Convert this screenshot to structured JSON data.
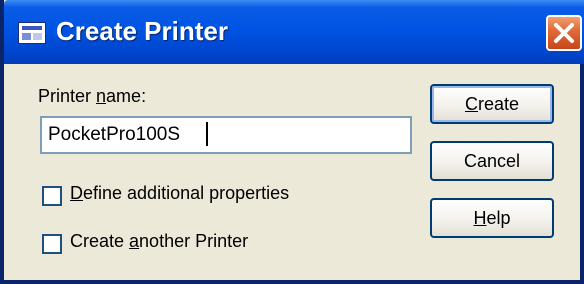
{
  "dialog": {
    "title": "Create Printer",
    "icon": "dialog-app-icon",
    "close_icon": "close-icon"
  },
  "printer_name": {
    "label_pre": "Printer ",
    "label_accel": "n",
    "label_post": "ame:",
    "value": "PocketPro100S"
  },
  "options": {
    "define_props": {
      "label_accel": "D",
      "label_post": "efine additional properties",
      "checked": false
    },
    "create_another": {
      "label_pre": "Create ",
      "label_accel": "a",
      "label_post": "nother Printer",
      "checked": false
    }
  },
  "buttons": {
    "create": {
      "accel": "C",
      "rest": "reate"
    },
    "cancel": {
      "label": "Cancel"
    },
    "help": {
      "accel": "H",
      "rest": "elp"
    }
  },
  "colors": {
    "titlebar": "#0054e3",
    "close_button": "#e26b3a",
    "dialog_face": "#ece9d8",
    "input_border": "#7f9db9",
    "button_border": "#003c74"
  }
}
